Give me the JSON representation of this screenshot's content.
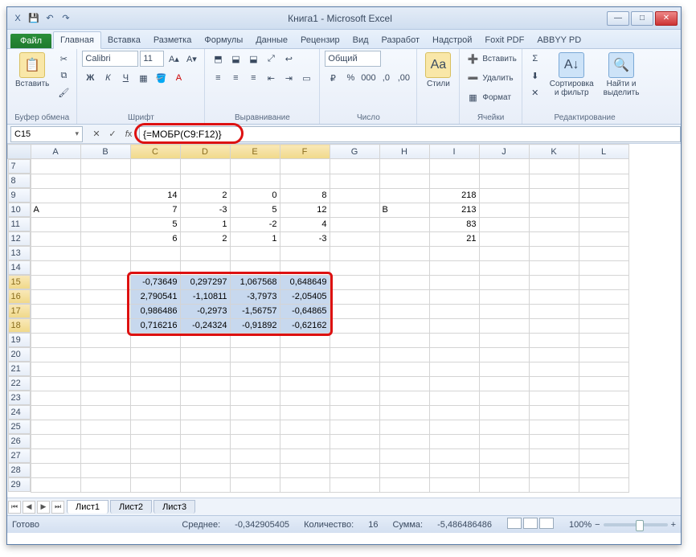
{
  "window": {
    "title": "Книга1  -  Microsoft Excel",
    "qat": {
      "excel": "X",
      "save": "💾",
      "undo": "↶",
      "redo": "↷"
    },
    "min": "—",
    "max": "□",
    "close": "✕"
  },
  "tabs": {
    "file": "Файл",
    "items": [
      "Главная",
      "Вставка",
      "Разметка",
      "Формулы",
      "Данные",
      "Рецензир",
      "Вид",
      "Разработ",
      "Надстрой",
      "Foxit PDF",
      "ABBYY PD"
    ],
    "active": 0
  },
  "ribbon": {
    "clipboard": {
      "paste": "Вставить",
      "label": "Буфер обмена"
    },
    "font": {
      "name": "Calibri",
      "size": "11",
      "bold": "Ж",
      "italic": "К",
      "underline": "Ч",
      "label": "Шрифт"
    },
    "align": {
      "label": "Выравнивание"
    },
    "number": {
      "fmt": "Общий",
      "label": "Число"
    },
    "styles": {
      "btn": "Стили",
      "label": ""
    },
    "cells": {
      "insert": "Вставить",
      "delete": "Удалить",
      "format": "Формат",
      "label": "Ячейки"
    },
    "editing": {
      "sort": "Сортировка\nи фильтр",
      "find": "Найти и\nвыделить",
      "label": "Редактирование"
    }
  },
  "nameBox": "C15",
  "formula": "{=МОБР(C9:F12)}",
  "columns": [
    "A",
    "B",
    "C",
    "D",
    "E",
    "F",
    "G",
    "H",
    "I",
    "J",
    "K",
    "L"
  ],
  "rows": [
    7,
    8,
    9,
    10,
    11,
    12,
    13,
    14,
    15,
    16,
    17,
    18,
    19,
    20,
    21,
    22,
    23,
    24,
    25,
    26,
    27,
    28,
    29
  ],
  "cells": {
    "A10": "A",
    "C9": "14",
    "D9": "2",
    "E9": "0",
    "F9": "8",
    "C10": "7",
    "D10": "-3",
    "E10": "5",
    "F10": "12",
    "C11": "5",
    "D11": "1",
    "E11": "-2",
    "F11": "4",
    "C12": "6",
    "D12": "2",
    "E12": "1",
    "F12": "-3",
    "H10": "B",
    "I9": "218",
    "I10": "213",
    "I11": "83",
    "I12": "21",
    "C15": "-0,73649",
    "D15": "0,297297",
    "E15": "1,067568",
    "F15": "0,648649",
    "C16": "2,790541",
    "D16": "-1,10811",
    "E16": "-3,7973",
    "F16": "-2,05405",
    "C17": "0,986486",
    "D17": "-0,2973",
    "E17": "-1,56757",
    "F17": "-0,64865",
    "C18": "0,716216",
    "D18": "-0,24324",
    "E18": "-0,91892",
    "F18": "-0,62162"
  },
  "selection": {
    "cols": [
      "C",
      "D",
      "E",
      "F"
    ],
    "rows": [
      15,
      16,
      17,
      18
    ]
  },
  "sheets": {
    "active": "Лист1",
    "others": [
      "Лист2",
      "Лист3"
    ]
  },
  "status": {
    "ready": "Готово",
    "avg_lbl": "Среднее:",
    "avg": "-0,342905405",
    "count_lbl": "Количество:",
    "count": "16",
    "sum_lbl": "Сумма:",
    "sum": "-5,486486486",
    "zoom": "100%"
  }
}
